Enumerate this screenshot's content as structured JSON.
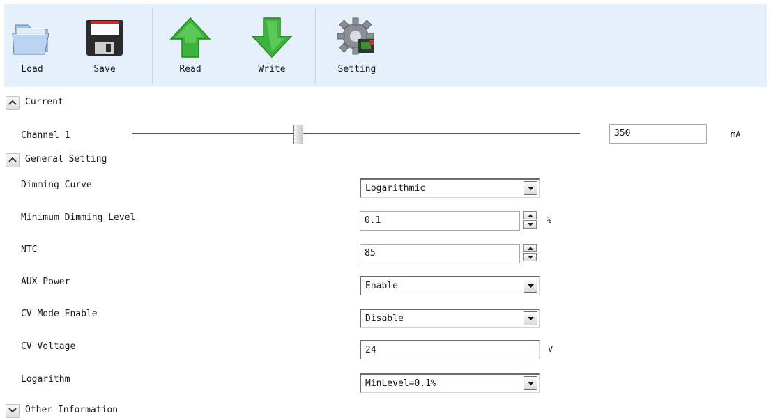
{
  "toolbar": {
    "load_label": "Load",
    "save_label": "Save",
    "read_label": "Read",
    "write_label": "Write",
    "setting_label": "Setting",
    "icons": [
      "folder-icon",
      "floppy-disk-icon",
      "arrow-up-icon",
      "arrow-down-icon",
      "gear-icon"
    ]
  },
  "sections": {
    "current": {
      "title": "Current",
      "expanded": true,
      "channel_label": "Channel 1",
      "slider_fraction": 0.37,
      "value": "350",
      "unit": "mA"
    },
    "general": {
      "title": "General Setting",
      "expanded": true,
      "rows": [
        {
          "label": "Dimming Curve",
          "type": "select",
          "value": "Logarithmic"
        },
        {
          "label": "Minimum Dimming Level",
          "type": "spinner",
          "value": "0.1",
          "unit": "%"
        },
        {
          "label": "NTC",
          "type": "spinner",
          "value": "85"
        },
        {
          "label": "AUX Power",
          "type": "select",
          "value": "Enable"
        },
        {
          "label": "CV Mode Enable",
          "type": "select",
          "value": "Disable"
        },
        {
          "label": "CV Voltage",
          "type": "text",
          "value": "24",
          "unit": "V"
        },
        {
          "label": "Logarithm",
          "type": "select",
          "value": "MinLevel=0.1%"
        }
      ]
    },
    "other": {
      "title": "Other Information",
      "expanded": false
    }
  },
  "colors": {
    "toolbar_bg": "#e6f0fb",
    "arrow_green": "#3cb33c",
    "save_red": "#d8262b"
  }
}
